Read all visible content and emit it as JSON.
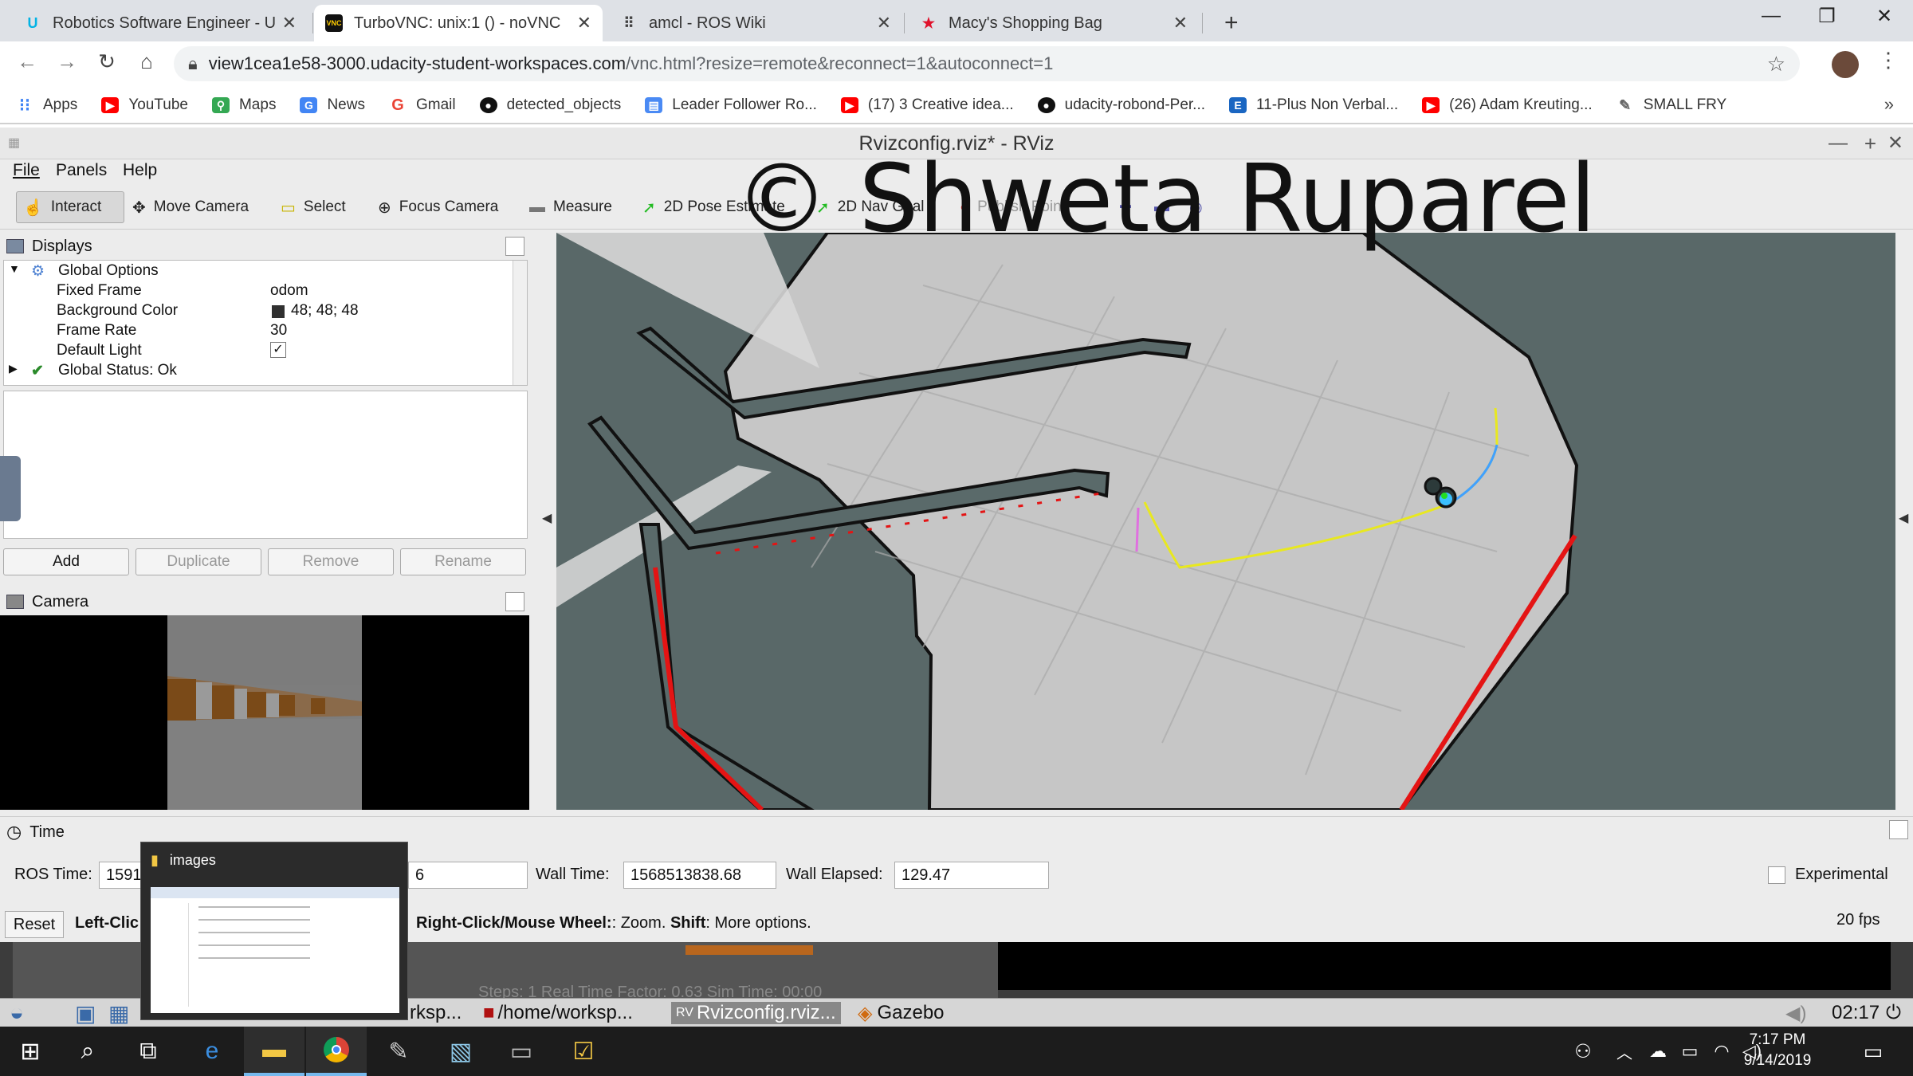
{
  "browser": {
    "tabs": [
      {
        "label": "Robotics Software Engineer - Ud",
        "icon": "udacity-icon",
        "active": false
      },
      {
        "label": "TurboVNC: unix:1 () - noVNC",
        "icon": "vnc-icon",
        "active": true
      },
      {
        "label": "amcl - ROS Wiki",
        "icon": "grid-icon",
        "active": false
      },
      {
        "label": "Macy's Shopping Bag",
        "icon": "star-icon",
        "active": false
      }
    ],
    "new_tab": "+",
    "url_host": "view1cea1e58-3000.udacity-student-workspaces.com",
    "url_path": "/vnc.html?resize=remote&reconnect=1&autoconnect=1",
    "bookmarks": [
      {
        "label": "Apps",
        "icon": "apps-grid-icon",
        "color": "#4285f4"
      },
      {
        "label": "YouTube",
        "icon": "youtube-icon",
        "color": "#ff0000"
      },
      {
        "label": "Maps",
        "icon": "maps-icon",
        "color": "#34a853"
      },
      {
        "label": "News",
        "icon": "news-icon",
        "color": "#4285f4"
      },
      {
        "label": "Gmail",
        "icon": "google-icon",
        "color": "#ea4335"
      },
      {
        "label": "detected_objects",
        "icon": "github-icon",
        "color": "#111111"
      },
      {
        "label": "Leader Follower Ro...",
        "icon": "doc-icon",
        "color": "#4a8af4"
      },
      {
        "label": "(17) 3 Creative idea...",
        "icon": "youtube-icon",
        "color": "#ff0000"
      },
      {
        "label": "udacity-robond-Per...",
        "icon": "github-icon",
        "color": "#111111"
      },
      {
        "label": "11-Plus Non Verbal...",
        "icon": "site-icon",
        "color": "#1a66c2"
      },
      {
        "label": "(26) Adam Kreuting...",
        "icon": "youtube-icon",
        "color": "#ff0000"
      },
      {
        "label": "SMALL FRY",
        "icon": "feather-icon",
        "color": "#666666"
      }
    ],
    "bookmarks_more": "»"
  },
  "rviz": {
    "title": "Rvizconfig.rviz* - RViz",
    "menu": [
      "File",
      "Panels",
      "Help"
    ],
    "tools": [
      {
        "label": "Interact",
        "glyph": "☝"
      },
      {
        "label": "Move Camera",
        "glyph": "✥"
      },
      {
        "label": "Select",
        "glyph": "▭"
      },
      {
        "label": "Focus Camera",
        "glyph": "⊕"
      },
      {
        "label": "Measure",
        "glyph": "▬"
      },
      {
        "label": "2D Pose Estimate",
        "glyph": "➚"
      },
      {
        "label": "2D Nav Goal",
        "glyph": "➚"
      },
      {
        "label": "Publish Point",
        "glyph": "●"
      }
    ],
    "watermark": "© Shweta Ruparel",
    "displays": {
      "header": "Displays",
      "rows": [
        {
          "key": "Global Options",
          "value": ""
        },
        {
          "key": "Fixed Frame",
          "value": "odom"
        },
        {
          "key": "Background Color",
          "value": "48; 48; 48"
        },
        {
          "key": "Frame Rate",
          "value": "30"
        },
        {
          "key": "Default Light",
          "value": "✓"
        },
        {
          "key": "Global Status: Ok",
          "value": ""
        }
      ],
      "buttons": [
        "Add",
        "Duplicate",
        "Remove",
        "Rename"
      ]
    },
    "camera": {
      "header": "Camera"
    },
    "time": {
      "header": "Time",
      "ros_time_label": "ROS Time:",
      "ros_time": "1591",
      "ros_elapsed_tail": "6",
      "wall_time_label": "Wall Time:",
      "wall_time": "1568513838.68",
      "wall_elapsed_label": "Wall Elapsed:",
      "wall_elapsed": "129.47",
      "experimental": "Experimental",
      "reset": "Reset",
      "hint_bold1": "Left-Clic",
      "hint_bold2": "Right-Click/Mouse Wheel:",
      "hint_text2": ": Zoom.",
      "hint_bold3": "Shift",
      "hint_text3": ": More options.",
      "fps": "20 fps"
    }
  },
  "gazebo_strip": {
    "text": "Steps: 1     Real Time Factor: 0.63     Sim Time: 00:00"
  },
  "vnc_taskbar": {
    "items": [
      "rksp...",
      "/home/worksp...",
      "Rvizconfig.rviz...",
      "Gazebo"
    ],
    "time": "02:17"
  },
  "thumbnail": {
    "title": "images"
  },
  "windows": {
    "time": "7:17 PM",
    "date": "9/14/2019"
  }
}
